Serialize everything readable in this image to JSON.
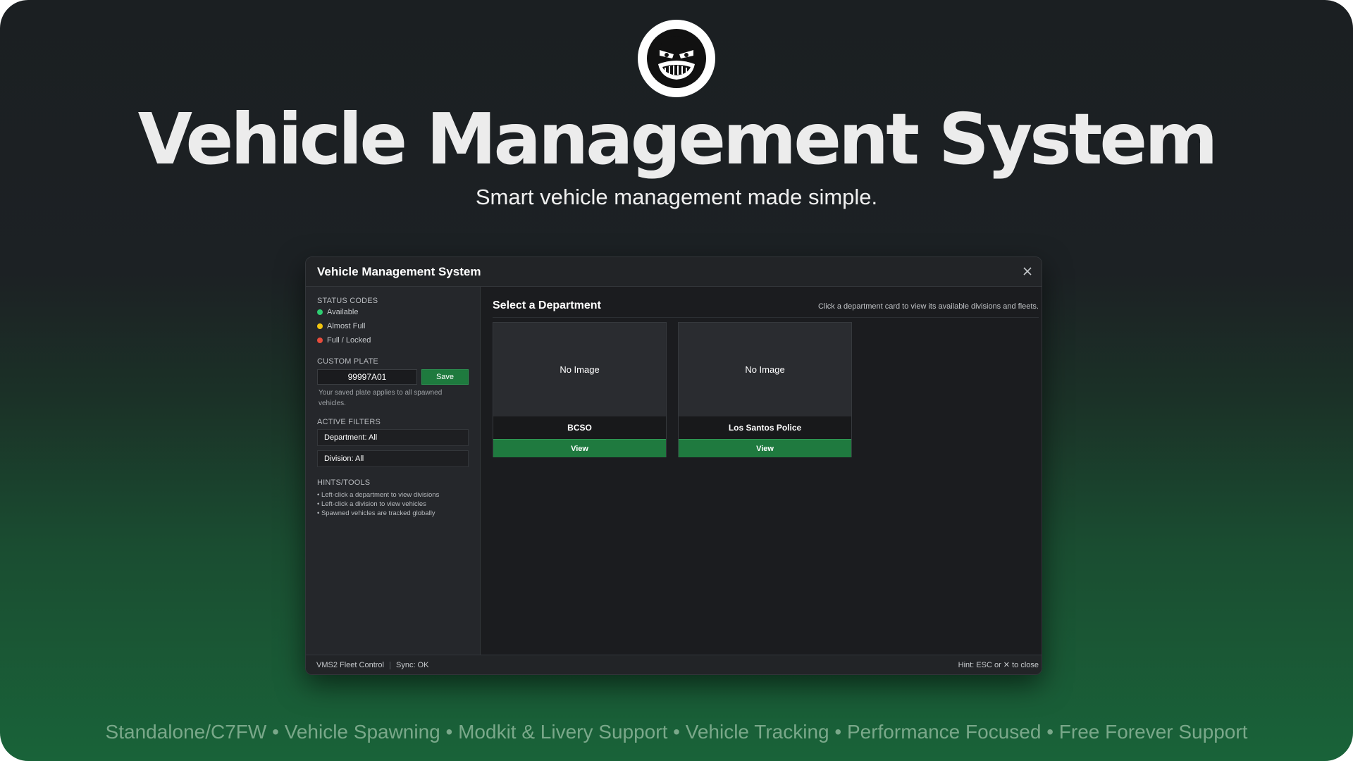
{
  "hero": {
    "title": "Vehicle Management System",
    "tagline": "Smart vehicle management made simple.",
    "features": "Standalone/C7FW • Vehicle Spawning • Modkit & Livery Support • Vehicle Tracking •  Performance Focused • Free Forever Support"
  },
  "window": {
    "title": "Vehicle Management System",
    "close_icon": "close-icon"
  },
  "sidebar": {
    "status_title": "STATUS CODES",
    "statuses": [
      {
        "label": "Available",
        "color": "#2ecc71"
      },
      {
        "label": "Almost Full",
        "color": "#f1c40f"
      },
      {
        "label": "Full / Locked",
        "color": "#e74c3c"
      }
    ],
    "plate_title": "CUSTOM PLATE",
    "plate_value": "99997A01",
    "save_label": "Save",
    "plate_note": "Your saved plate applies to all spawned vehicles.",
    "filters_title": "ACTIVE FILTERS",
    "filters": [
      "Department: All",
      "Division: All"
    ],
    "hints_title": "HINTS/TOOLS",
    "hints": [
      "• Left-click a department to view divisions",
      "• Left-click a division to view vehicles",
      "• Spawned vehicles are tracked globally"
    ]
  },
  "main": {
    "title": "Select a Department",
    "help": "Click a department card to view its available divisions and fleets.",
    "cards": [
      {
        "image_text": "No Image",
        "name": "BCSO",
        "button": "View"
      },
      {
        "image_text": "No Image",
        "name": "Los Santos Police",
        "button": "View"
      }
    ]
  },
  "footer": {
    "app": "VMS2 Fleet Control",
    "sync": "Sync: OK",
    "hint": "Hint: ESC or ✕ to close"
  },
  "colors": {
    "accent_green": "#1f7a3f",
    "background_top": "#1c2124",
    "background_bottom": "#196339"
  }
}
